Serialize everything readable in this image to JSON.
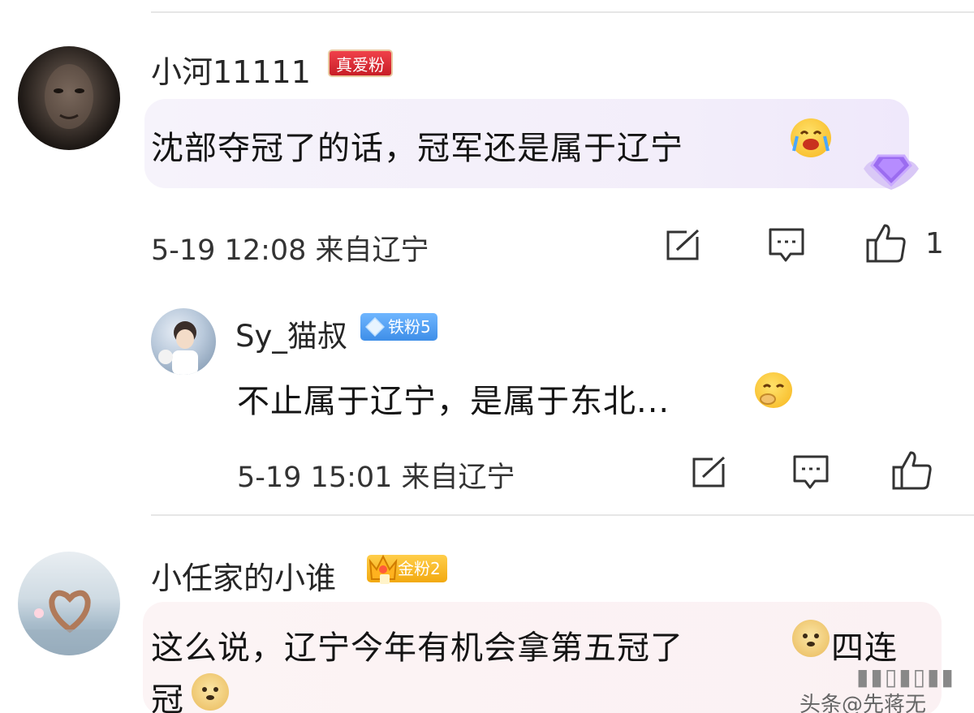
{
  "comments": [
    {
      "username": "小河11111",
      "badge": "真爱粉",
      "text": "沈部夺冠了的话，冠军还是属于辽宁",
      "meta": "5-19 12:08 来自辽宁",
      "like_count": "1",
      "emoji": "laugh-cry-emoji"
    },
    {
      "username": "Sy_猫叔",
      "badge": "铁粉5",
      "text": "不止属于辽宁，是属于东北...",
      "meta": "5-19 15:01 来自辽宁",
      "emoji": "yawn-emoji"
    },
    {
      "username": "小任家的小谁",
      "badge": "金粉2",
      "text_line1a": "这么说，辽宁今年有机会拿第五冠了",
      "text_line1b": "四连",
      "text_line2": "冠",
      "emoji": "doge-emoji"
    }
  ],
  "watermark": "头条@先蒋无",
  "colors": {
    "accent_red": "#d9252f",
    "badge_blue": "#4b97ee",
    "badge_gold": "#f2a90f",
    "bubble_purple": "#f3eefa",
    "bubble_pink": "#fbf1f3"
  }
}
